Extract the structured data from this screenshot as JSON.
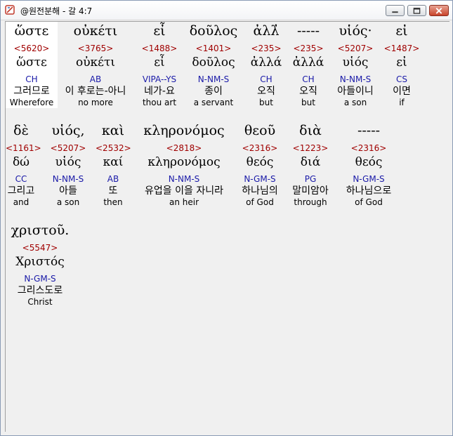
{
  "window": {
    "title": "@원전분해 - 갈 4:7"
  },
  "rows": [
    [
      {
        "g": "ὥστε",
        "n": "<5620>",
        "l": "ὥστε",
        "c": "CH",
        "k": "그러므로",
        "e": "Wherefore"
      },
      {
        "g": "οὐκέτι",
        "n": "<3765>",
        "l": "οὐκέτι",
        "c": "AB",
        "k": "이 후로는-아니",
        "e": "no more"
      },
      {
        "g": "εἶ",
        "n": "<1488>",
        "l": "εἶ",
        "c": "VIPA--YS",
        "k": "네가-요",
        "e": "thou art"
      },
      {
        "g": "δοῦλος",
        "n": "<1401>",
        "l": "δοῦλος",
        "c": "N-NM-S",
        "k": "종이",
        "e": "a servant"
      },
      {
        "g": "ἀλλ̓",
        "n": "<235>",
        "l": "ἀλλά",
        "c": "CH",
        "k": "오직",
        "e": "but"
      },
      {
        "g": "-----",
        "n": "<235>",
        "l": "ἀλλά",
        "c": "CH",
        "k": "오직",
        "e": "but"
      },
      {
        "g": "υἱός·",
        "n": "<5207>",
        "l": "υἱός",
        "c": "N-NM-S",
        "k": "아들이니",
        "e": "a son"
      },
      {
        "g": "εἰ",
        "n": "<1487>",
        "l": "εἰ",
        "c": "CS",
        "k": "이면",
        "e": "if"
      }
    ],
    [
      {
        "g": "δὲ",
        "n": "<1161>",
        "l": "δώ",
        "c": "CC",
        "k": "그리고",
        "e": "and"
      },
      {
        "g": "υἱός,",
        "n": "<5207>",
        "l": "υἱός",
        "c": "N-NM-S",
        "k": "아들",
        "e": "a son"
      },
      {
        "g": "καὶ",
        "n": "<2532>",
        "l": "καί",
        "c": "AB",
        "k": "또",
        "e": "then"
      },
      {
        "g": "κληρονόμος",
        "n": "<2818>",
        "l": "κληρονόμος",
        "c": "N-NM-S",
        "k": "유업을 이을 자니라",
        "e": "an heir"
      },
      {
        "g": "θεοῦ",
        "n": "<2316>",
        "l": "θεός",
        "c": "N-GM-S",
        "k": "하나님의",
        "e": "of God"
      },
      {
        "g": "διὰ",
        "n": "<1223>",
        "l": "διά",
        "c": "PG",
        "k": "말미암아",
        "e": "through"
      },
      {
        "g": "-----",
        "n": "<2316>",
        "l": "θεός",
        "c": "N-GM-S",
        "k": "하나님으로",
        "e": "of God"
      }
    ],
    [
      {
        "g": "χριστοῦ.",
        "n": "<5547>",
        "l": "Χριστός",
        "c": "N-GM-S",
        "k": "그리스도로",
        "e": "Christ"
      }
    ]
  ]
}
